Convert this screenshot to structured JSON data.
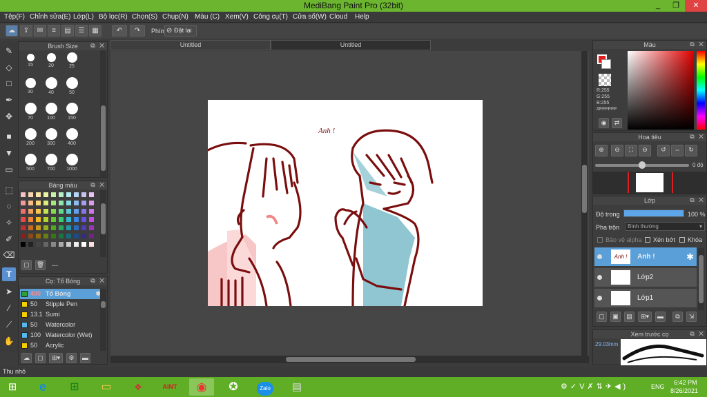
{
  "window": {
    "title": "MediBang Paint Pro (32bit)",
    "controls": [
      "_",
      "❐",
      "✕"
    ]
  },
  "menu": [
    "Tệp(F)",
    "Chỉnh sửa(E)",
    "Lớp(L)",
    "Bộ lọc(R)",
    "Chọn(S)",
    "Chụp(N)",
    "Màu (C)",
    "Xem(V)",
    "Công cụ(T)",
    "Cửa số(W)",
    "Cloud",
    "Help"
  ],
  "toolbar": {
    "phim_label": "Phím",
    "reset_label": "Đặt lại"
  },
  "tabs": [
    "Untitled",
    "Untitled"
  ],
  "brush_size": {
    "title": "Brush Size",
    "sizes": [
      "15",
      "20",
      "25",
      "30",
      "40",
      "50",
      "70",
      "100",
      "150",
      "200",
      "300",
      "400",
      "500",
      "700",
      "1000"
    ]
  },
  "palette": {
    "title": "Bảng màu",
    "footer": "---",
    "colors": [
      "#f4c2c2",
      "#f9d5b0",
      "#fbe6a8",
      "#e9f5a5",
      "#c8f0a8",
      "#b7f0c8",
      "#b0e9ee",
      "#b6d6f7",
      "#c8c2f4",
      "#e8c2f2",
      "#f29a9a",
      "#f7bb86",
      "#f8d77a",
      "#d8ee7c",
      "#a7e57e",
      "#8fe6ad",
      "#86d9e5",
      "#8dbbf2",
      "#a89cf0",
      "#dc9cee",
      "#ee6f6f",
      "#f3a05e",
      "#f5c94f",
      "#c5e254",
      "#84d855",
      "#63da8f",
      "#5cc8dc",
      "#639fee",
      "#8676ec",
      "#cf75e8",
      "#e64a4a",
      "#ef8536",
      "#f1ba25",
      "#b2d72c",
      "#63cb2d",
      "#38ce72",
      "#33b8d4",
      "#3a85ea",
      "#6652e8",
      "#c24fe2",
      "#c03030",
      "#c86a22",
      "#c99a18",
      "#93b21d",
      "#4fa81e",
      "#27a85b",
      "#2496ad",
      "#2a6cc0",
      "#4f3dbd",
      "#9c38b8",
      "#8a1f1f",
      "#8e4a15",
      "#8e6c10",
      "#687e12",
      "#377713",
      "#1a7640",
      "#186a7b",
      "#1c4c88",
      "#362a86",
      "#6e2682",
      "#000000",
      "#222222",
      "#444444",
      "#666666",
      "#888888",
      "#aaaaaa",
      "#cccccc",
      "#eeeeee",
      "#ffffff",
      "#ffe0e0"
    ]
  },
  "brushes": {
    "title": "Cọ: Tổ Bóng",
    "items": [
      {
        "size": "400",
        "name": "Tổ Bóng",
        "color": "#2f9e3a",
        "selected": true
      },
      {
        "size": "50",
        "name": "Stipple Pen",
        "color": "#f5d000",
        "selected": false
      },
      {
        "size": "13.1",
        "name": "Sumi",
        "color": "#f5d000",
        "selected": false
      },
      {
        "size": "50",
        "name": "Watercolor",
        "color": "#57b8f0",
        "selected": false
      },
      {
        "size": "100",
        "name": "Watercolor (Wet)",
        "color": "#57b8f0",
        "selected": false
      },
      {
        "size": "50",
        "name": "Acrylic",
        "color": "#f5d000",
        "selected": false
      }
    ]
  },
  "canvas": {
    "speech": "Anh !"
  },
  "color_panel": {
    "title": "Màu",
    "r": "R:255",
    "g": "G:255",
    "b": "B:255",
    "hex": "#FFFFFF"
  },
  "navigator": {
    "title": "Hoa tiêu",
    "angle": "0 độ"
  },
  "layer_panel": {
    "title": "Lớp",
    "opacity_label": "Độ trong",
    "opacity_value": "100 %",
    "opacity_fraction": 1.0,
    "blend_label": "Pha trộn",
    "blend_value": "Bình thường",
    "protect_alpha": "Bảo vệ alpha",
    "clip": "Xén bớt",
    "lock": "Khóa",
    "layers": [
      {
        "name": "Anh !",
        "thumb_text": "Anh !",
        "selected": true
      },
      {
        "name": "Lớp2",
        "thumb_text": "",
        "selected": false
      },
      {
        "name": "Lớp1",
        "thumb_text": "",
        "selected": false
      }
    ]
  },
  "brush_preview": {
    "title": "Xem trước cọ",
    "size": "29.03mm"
  },
  "status": {
    "label": "Thu nhỏ"
  },
  "taskbar": {
    "apps": [
      "ie-icon",
      "store-icon",
      "explorer-icon",
      "app-icon",
      "paint-icon",
      "medibang-icon",
      "firealpaca-icon",
      "zalo-icon",
      "document-icon"
    ],
    "zalo": "Zalo",
    "lang": "ENG",
    "time": "6:42 PM",
    "date": "8/26/2021"
  }
}
